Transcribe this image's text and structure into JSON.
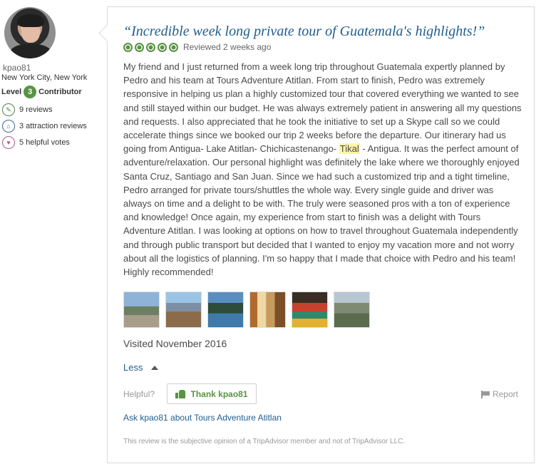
{
  "member": {
    "username": "kpao81",
    "location": "New York City, New York",
    "level_label": "Level",
    "level_number": "3",
    "level_title": "Contributor",
    "stats": [
      {
        "icon": "review-icon",
        "text": "9 reviews"
      },
      {
        "icon": "attraction-icon",
        "text": "3 attraction reviews"
      },
      {
        "icon": "helpful-vote-icon",
        "text": "5 helpful votes"
      }
    ]
  },
  "review": {
    "title": "“Incredible week long private tour of Guatemala's highlights!”",
    "rating_bubbles": 5,
    "reviewed_text": "Reviewed 2 weeks ago",
    "body_part1": "My friend and I just returned from a week long trip throughout Guatemala expertly planned by Pedro and his team at Tours Adventure Atitlan. From start to finish, Pedro was extremely responsive in helping us plan a highly customized tour that covered everything we wanted to see and still stayed within our budget. He was always extremely patient in answering all my questions and requests. I also appreciated that he took the initiative to set up a Skype call so we could accelerate things since we booked our trip 2 weeks before the departure. Our itinerary had us going from Antigua- Lake Atitlan- Chichicastenango- ",
    "body_highlight": "Tikal",
    "body_part2": " - Antigua. It was the perfect amount of adventure/relaxation. Our personal highlight was definitely the lake where we thoroughly enjoyed Santa Cruz, Santiago and San Juan. Since we had such a customized trip and a tight timeline, Pedro arranged for private tours/shuttles the whole way. Every single guide and driver was always on time and a delight to be with. The truly were seasoned pros with a ton of experience and knowledge! Once again, my experience from start to finish was a delight with Tours Adventure Atitlan. I was looking at options on how to travel throughout Guatemala independently and through public transport but decided that I wanted to enjoy my vacation more and not worry about all the logistics of planning. I'm so happy that I made that choice with Pedro and his team! Highly recommended!",
    "photos_count": 6,
    "visited": "Visited November 2016",
    "less_label": "Less",
    "helpful_label": "Helpful?",
    "thank_label": "Thank kpao81",
    "report_label": "Report",
    "ask_link": "Ask kpao81 about Tours Adventure Atitlan",
    "disclaimer": "This review is the subjective opinion of a TripAdvisor member and not of TripAdvisor LLC."
  },
  "colors": {
    "bubble_green": "#589442",
    "title_blue": "#1f5e8f",
    "highlight": "#fff4a6"
  }
}
